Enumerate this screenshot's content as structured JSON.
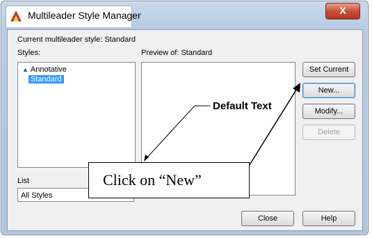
{
  "window": {
    "title": "Multileader Style Manager",
    "close_glyph": "X"
  },
  "current_style": {
    "label": "Current multileader style: Standard"
  },
  "styles": {
    "label_text": "Styles:",
    "items": [
      {
        "label": "Annotative",
        "icon": "annotative-triangle-icon"
      },
      {
        "label": "Standard",
        "selected": true
      }
    ]
  },
  "preview": {
    "label": "Preview of: Standard",
    "sample_text": "Default Text"
  },
  "buttons": {
    "set_current": "Set Current",
    "new": "New...",
    "modify": "Modify...",
    "delete": "Delete",
    "close": "Close",
    "help": "Help"
  },
  "list_filter": {
    "label": "List",
    "value": "All Styles"
  },
  "annotation": {
    "callout_text": "Click on  “New”"
  },
  "colors": {
    "selection": "#3399ff",
    "close_button": "#c74a33",
    "title_bar": "#b7cbe3"
  }
}
